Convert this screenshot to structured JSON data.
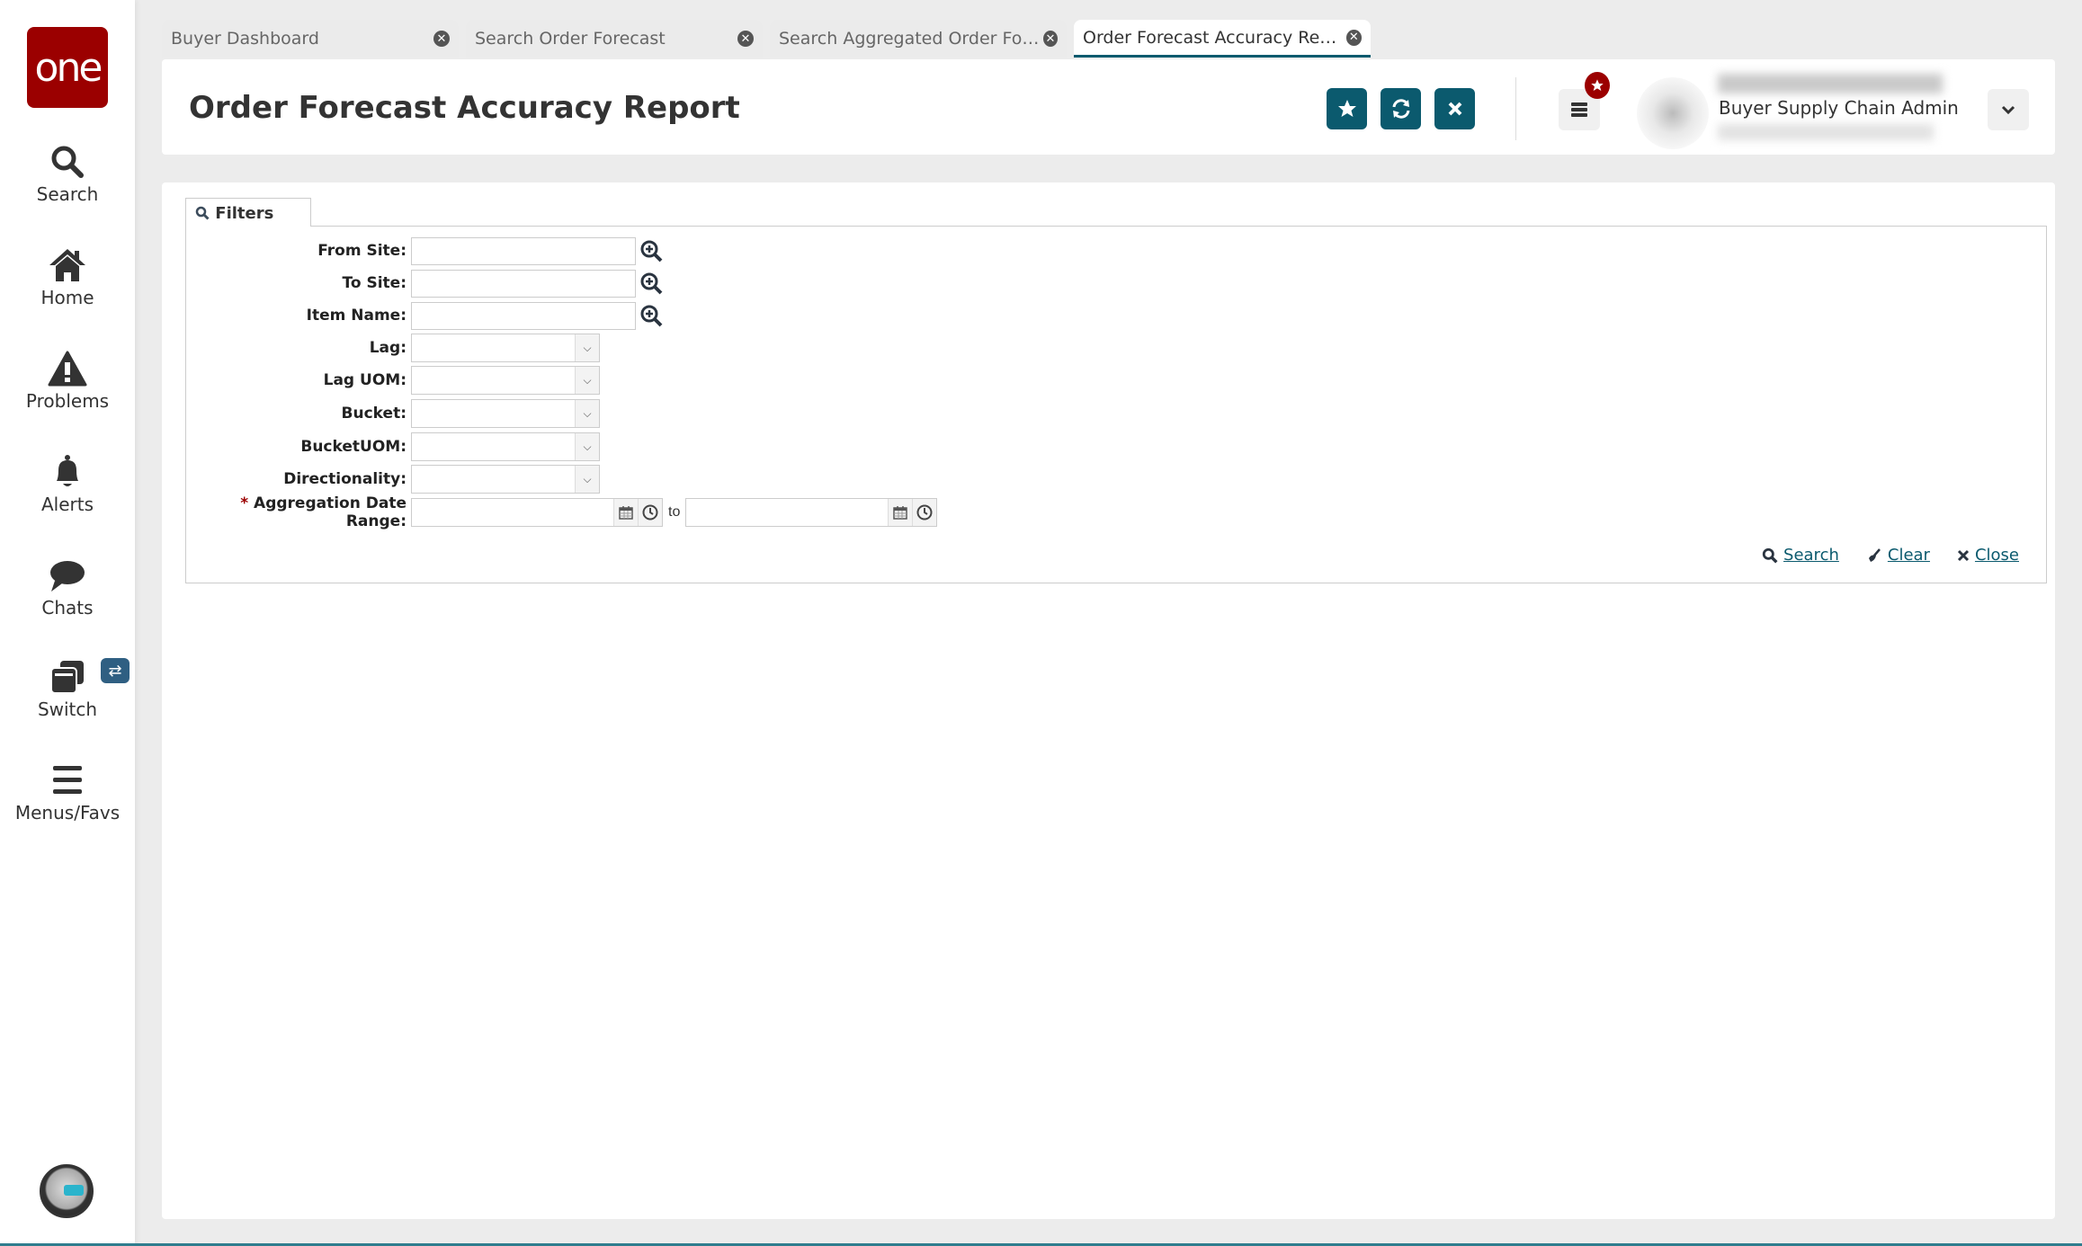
{
  "sidebar": {
    "logo": "one",
    "items": [
      {
        "label": "Search",
        "icon": "search-icon"
      },
      {
        "label": "Home",
        "icon": "home-icon"
      },
      {
        "label": "Problems",
        "icon": "warning-icon"
      },
      {
        "label": "Alerts",
        "icon": "bell-icon"
      },
      {
        "label": "Chats",
        "icon": "chat-icon"
      },
      {
        "label": "Switch",
        "icon": "switch-icon"
      },
      {
        "label": "Menus/Favs",
        "icon": "menu-icon"
      }
    ],
    "switch_badge": "⇄"
  },
  "tabs": [
    {
      "label": "Buyer Dashboard",
      "active": false
    },
    {
      "label": "Search Order Forecast",
      "active": false
    },
    {
      "label": "Search Aggregated Order Foreca...",
      "active": false
    },
    {
      "label": "Order Forecast Accuracy Report",
      "active": true
    }
  ],
  "header": {
    "title": "Order Forecast Accuracy Report",
    "user_role": "Buyer Supply Chain Admin",
    "accent_color": "#0b5a6e"
  },
  "filters": {
    "tab_label": "Filters",
    "fields": {
      "from_site": {
        "label": "From Site:",
        "value": ""
      },
      "to_site": {
        "label": "To Site:",
        "value": ""
      },
      "item_name": {
        "label": "Item Name:",
        "value": ""
      },
      "lag": {
        "label": "Lag:",
        "value": ""
      },
      "lag_uom": {
        "label": "Lag UOM:",
        "value": ""
      },
      "bucket": {
        "label": "Bucket:",
        "value": ""
      },
      "bucket_uom": {
        "label": "BucketUOM:",
        "value": ""
      },
      "directionality": {
        "label": "Directionality:",
        "value": ""
      },
      "aggregation_date_range": {
        "label": "Aggregation Date Range:",
        "required_mark": "*",
        "from": "",
        "to": "",
        "to_label": "to"
      }
    },
    "actions": {
      "search": "Search",
      "clear": "Clear",
      "close": "Close"
    }
  }
}
